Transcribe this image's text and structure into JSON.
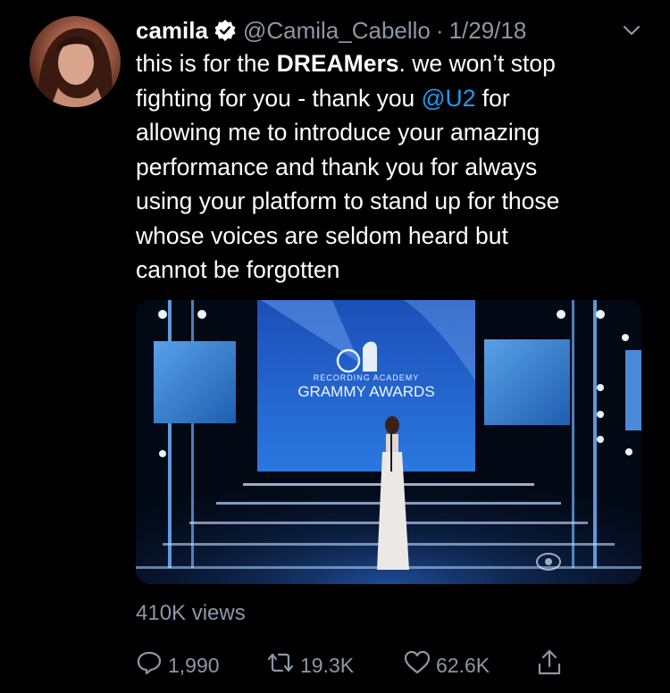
{
  "tweet": {
    "name": "camila",
    "handle": "@Camila_Cabello",
    "separator": "·",
    "date": "1/29/18",
    "text_lines": [
      [
        "this is for the ",
        "DREAMers",
        ". we won’t stop"
      ],
      [
        "fighting for you  - thank you ",
        "@U2",
        " for"
      ],
      [
        "allowing me to introduce your amazing"
      ],
      [
        "performance and thank you for always"
      ],
      [
        "using your platform to stand up for those"
      ],
      [
        "whose voices are seldom heard but"
      ],
      [
        "cannot be forgotten"
      ]
    ],
    "media": {
      "logo_top": "RECORDING ACADEMY",
      "logo_main": "GRAMMY AWARDS",
      "logo_number": "60"
    },
    "views": "410K views",
    "actions": {
      "replies": "1,990",
      "retweets": "19.3K",
      "likes": "62.6K"
    }
  },
  "icons": [
    "verified-badge-icon",
    "chevron-down-icon",
    "reply-icon",
    "retweet-icon",
    "like-icon",
    "share-icon"
  ],
  "colors": {
    "background": "#000000",
    "text": "#ffffff",
    "secondary": "#8b98a5",
    "link": "#1d9bf0"
  }
}
